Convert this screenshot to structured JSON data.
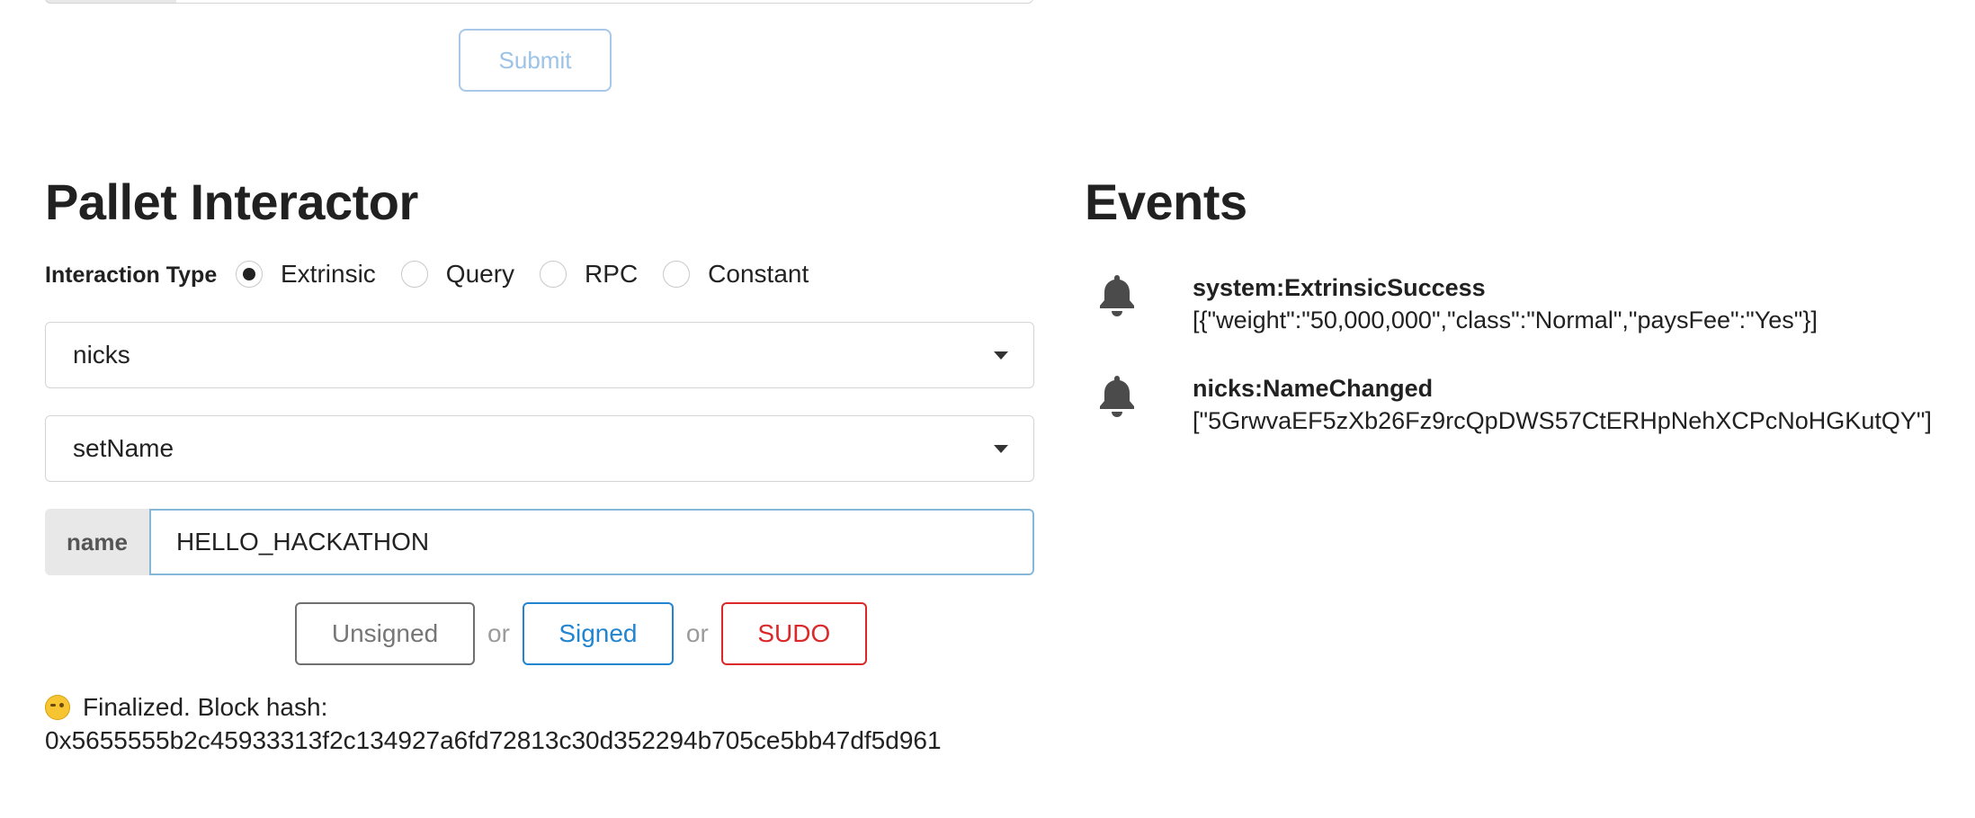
{
  "top_form": {
    "submit_label": "Submit"
  },
  "pallet_interactor": {
    "title": "Pallet Interactor",
    "interaction_type_label": "Interaction Type",
    "interaction_types": [
      {
        "label": "Extrinsic",
        "checked": true
      },
      {
        "label": "Query",
        "checked": false
      },
      {
        "label": "RPC",
        "checked": false
      },
      {
        "label": "Constant",
        "checked": false
      }
    ],
    "pallet_select_value": "nicks",
    "callable_select_value": "setName",
    "param_label": "name",
    "param_value": "HELLO_HACKATHON",
    "buttons": {
      "unsigned": "Unsigned",
      "or": "or",
      "signed": "Signed",
      "sudo": "SUDO"
    },
    "status": {
      "emoji": "wink-emoji",
      "text": "Finalized. Block hash:",
      "hash": "0x5655555b2c45933313f2c134927a6fd72813c30d352294b705ce5bb47df5d961"
    }
  },
  "events": {
    "title": "Events",
    "items": [
      {
        "icon": "bell-icon",
        "name": "system:ExtrinsicSuccess",
        "data": "[{\"weight\":\"50,000,000\",\"class\":\"Normal\",\"paysFee\":\"Yes\"}]"
      },
      {
        "icon": "bell-icon",
        "name": "nicks:NameChanged",
        "data": "[\"5GrwvaEF5zXb26Fz9rcQpDWS57CtERHpNehXCPcNoHGKutQY\"]"
      }
    ]
  },
  "colors": {
    "signed": "#2185d0",
    "sudo": "#db2828",
    "submit_disabled": "#9cc2e5",
    "param_input_border": "#85b7d9"
  }
}
